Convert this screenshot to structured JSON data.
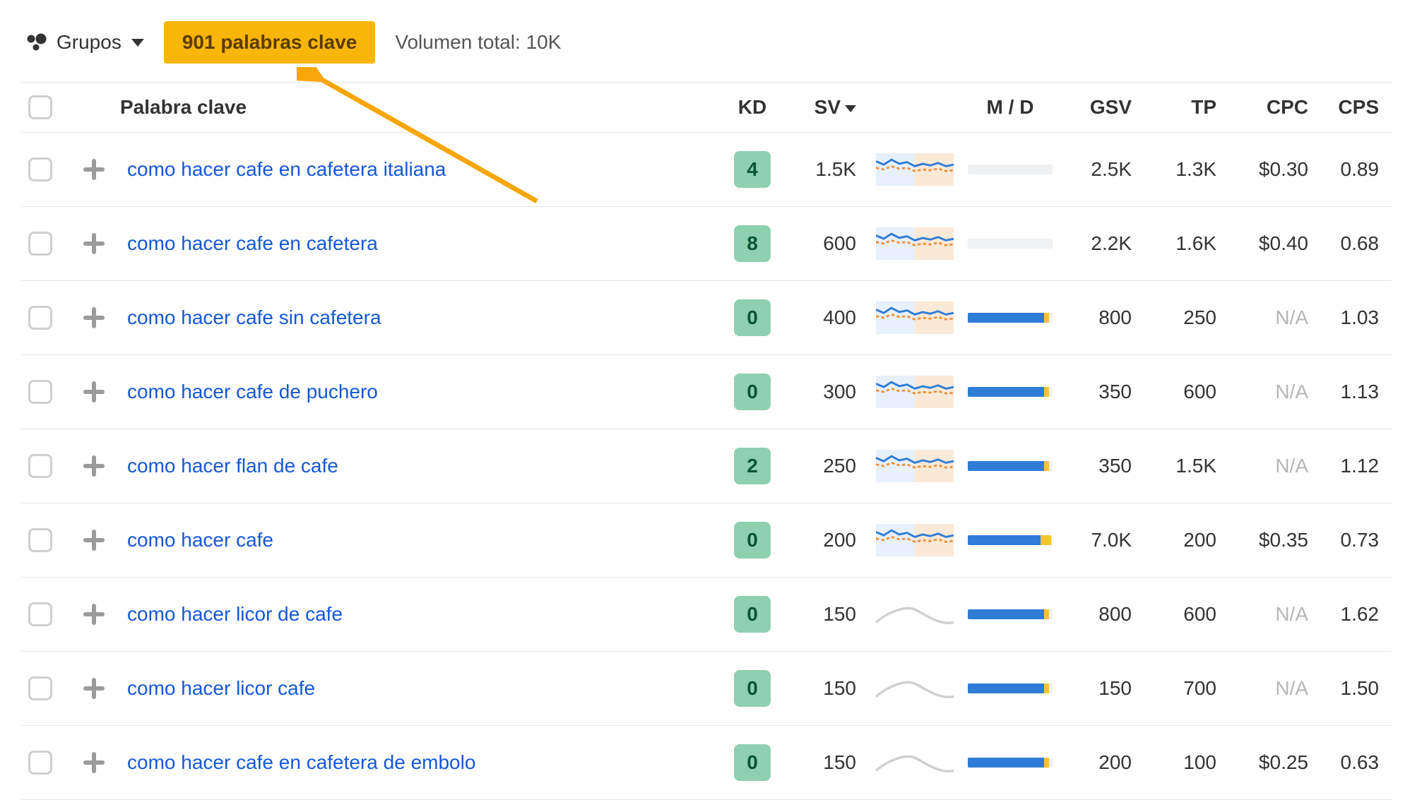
{
  "toolbar": {
    "grupos_label": "Grupos",
    "chip_label": "901 palabras clave",
    "total_volume_label": "Volumen total: 10K"
  },
  "columns": {
    "keyword": "Palabra clave",
    "kd": "KD",
    "sv": "SV",
    "md": "M / D",
    "gsv": "GSV",
    "tp": "TP",
    "cpc": "CPC",
    "cps": "CPS"
  },
  "rows": [
    {
      "keyword": "como hacer cafe en cafetera italiana",
      "kd": "4",
      "sv": "1.5K",
      "md_blue": 0,
      "md_yellow": 0,
      "gsv": "2.5K",
      "tp": "1.3K",
      "cpc": "$0.30",
      "cps": "0.89",
      "trend": "colored"
    },
    {
      "keyword": "como hacer cafe en cafetera",
      "kd": "8",
      "sv": "600",
      "md_blue": 0,
      "md_yellow": 0,
      "gsv": "2.2K",
      "tp": "1.6K",
      "cpc": "$0.40",
      "cps": "0.68",
      "trend": "colored"
    },
    {
      "keyword": "como hacer cafe sin cafetera",
      "kd": "0",
      "sv": "400",
      "md_blue": 90,
      "md_yellow": 6,
      "gsv": "800",
      "tp": "250",
      "cpc": "N/A",
      "cps": "1.03",
      "trend": "colored"
    },
    {
      "keyword": "como hacer cafe de puchero",
      "kd": "0",
      "sv": "300",
      "md_blue": 90,
      "md_yellow": 6,
      "gsv": "350",
      "tp": "600",
      "cpc": "N/A",
      "cps": "1.13",
      "trend": "colored"
    },
    {
      "keyword": "como hacer flan de cafe",
      "kd": "2",
      "sv": "250",
      "md_blue": 90,
      "md_yellow": 6,
      "gsv": "350",
      "tp": "1.5K",
      "cpc": "N/A",
      "cps": "1.12",
      "trend": "colored"
    },
    {
      "keyword": "como hacer cafe",
      "kd": "0",
      "sv": "200",
      "md_blue": 86,
      "md_yellow": 12,
      "gsv": "7.0K",
      "tp": "200",
      "cpc": "$0.35",
      "cps": "0.73",
      "trend": "colored"
    },
    {
      "keyword": "como hacer licor de cafe",
      "kd": "0",
      "sv": "150",
      "md_blue": 90,
      "md_yellow": 6,
      "gsv": "800",
      "tp": "600",
      "cpc": "N/A",
      "cps": "1.62",
      "trend": "gray"
    },
    {
      "keyword": "como hacer licor cafe",
      "kd": "0",
      "sv": "150",
      "md_blue": 90,
      "md_yellow": 6,
      "gsv": "150",
      "tp": "700",
      "cpc": "N/A",
      "cps": "1.50",
      "trend": "gray"
    },
    {
      "keyword": "como hacer cafe en cafetera de embolo",
      "kd": "0",
      "sv": "150",
      "md_blue": 90,
      "md_yellow": 6,
      "gsv": "200",
      "tp": "100",
      "cpc": "$0.25",
      "cps": "0.63",
      "trend": "gray"
    }
  ]
}
